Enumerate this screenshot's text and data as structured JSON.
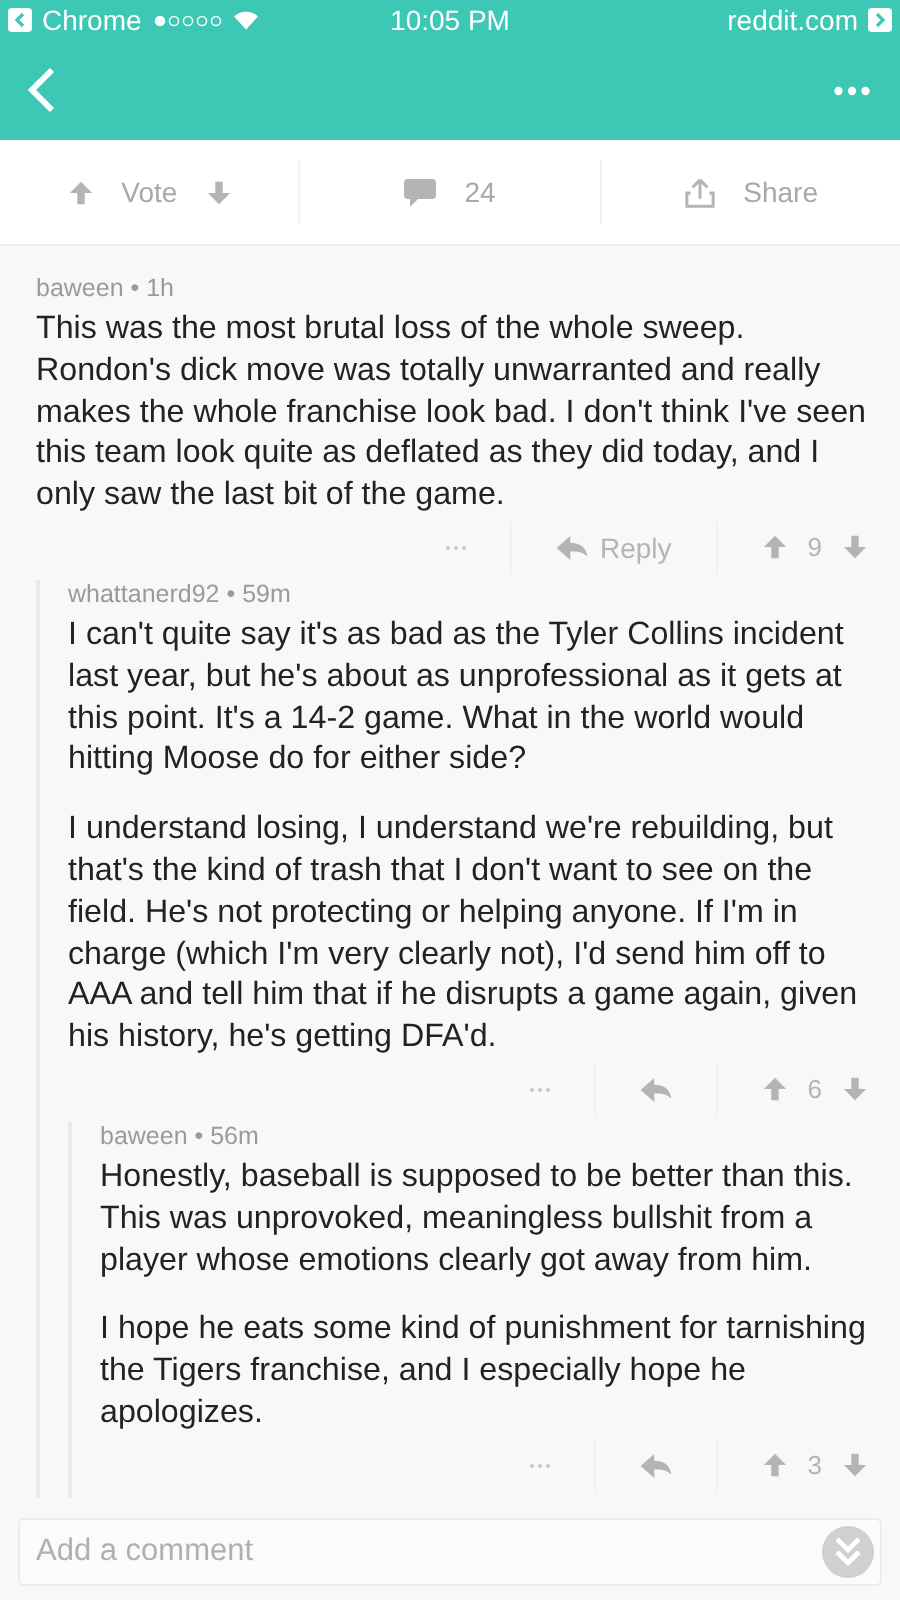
{
  "status_bar": {
    "back_app": "Chrome",
    "time": "10:05 PM",
    "site": "reddit.com"
  },
  "post_actions": {
    "vote_label": "Vote",
    "comment_count": "24",
    "share_label": "Share"
  },
  "comments": [
    {
      "byline": "baween • 1h",
      "paragraphs": [
        "This was the most brutal loss of the whole sweep. Rondon's dick move was totally unwarranted and really makes the whole franchise look bad. I don't think I've seen this team look quite as deflated as they did today, and I only saw the last bit of the game."
      ],
      "reply_label": "Reply",
      "score": "9",
      "children": [
        {
          "byline": "whattanerd92 • 59m",
          "paragraphs": [
            "I can't quite say it's as bad as the Tyler Collins incident last year, but he's about as unprofessional as it gets at this point. It's a 14-2 game. What in the world would hitting Moose do for either side?",
            "I understand losing, I understand we're rebuilding, but that's the kind of trash that I don't want to see on the field. He's not protecting or helping anyone. If I'm in charge (which I'm very clearly not), I'd send him off to AAA and tell him that if he disrupts a game again, given his history, he's getting DFA'd."
          ],
          "score": "6",
          "children": [
            {
              "byline": "baween • 56m",
              "paragraphs": [
                "Honestly, baseball is supposed to be better than this. This was unprovoked, meaningless bullshit from a player whose emotions clearly got away from him.",
                "I hope he eats some kind of punishment for tarnishing the Tigers franchise, and I especially hope he apologizes."
              ],
              "score": "3"
            }
          ]
        }
      ]
    }
  ],
  "comment_box": {
    "placeholder": "Add a comment"
  }
}
